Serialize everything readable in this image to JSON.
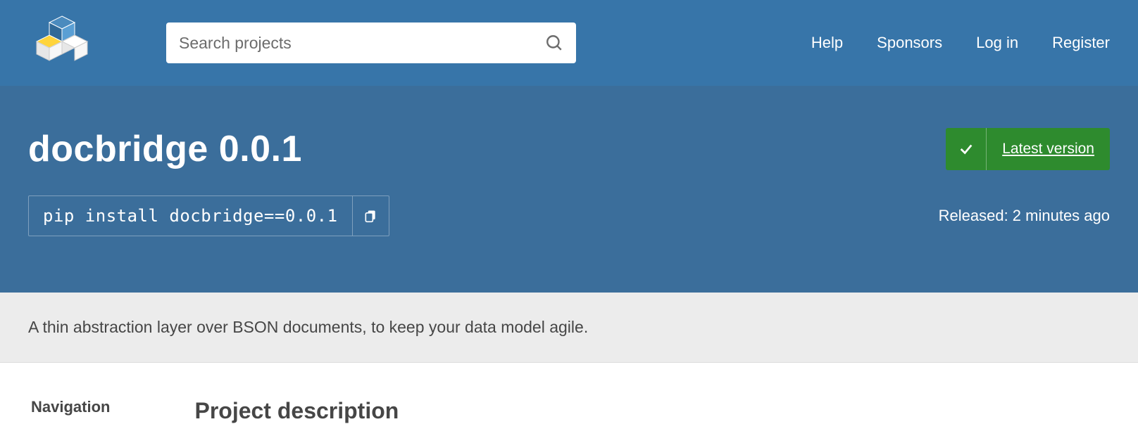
{
  "header": {
    "search_placeholder": "Search projects",
    "nav": {
      "help": "Help",
      "sponsors": "Sponsors",
      "login": "Log in",
      "register": "Register"
    }
  },
  "hero": {
    "title": "docbridge 0.0.1",
    "latest_label": "Latest version",
    "pip_command": "pip install docbridge==0.0.1",
    "released": "Released: 2 minutes ago"
  },
  "summary": "A thin abstraction layer over BSON documents, to keep your data model agile.",
  "sidebar": {
    "navigation_heading": "Navigation"
  },
  "main": {
    "description_heading": "Project description"
  }
}
